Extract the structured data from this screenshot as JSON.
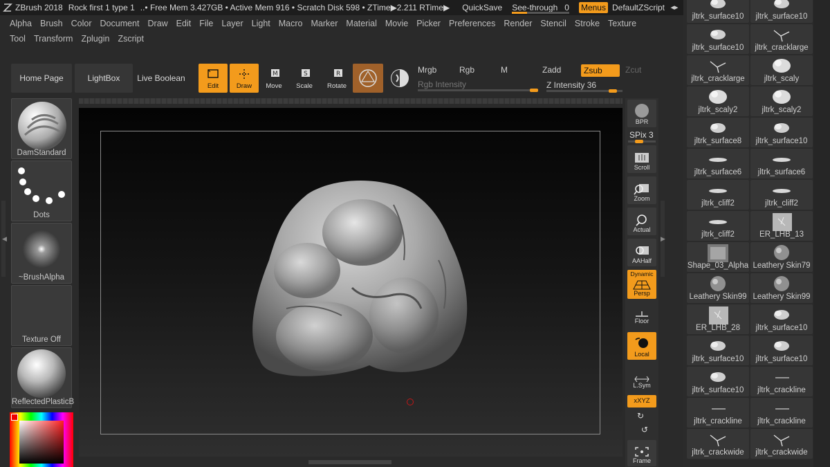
{
  "titlebar": {
    "app": "ZBrush 2018",
    "doc": "Rock first 1 type 1",
    "mem": "..• Free Mem 3.427GB • Active Mem 916 • Scratch Disk 598 • ZTime▶2.211 RTime▶",
    "quicksave": "QuickSave",
    "seethrough": "See-through",
    "seethrough_value": "0",
    "menus": "Menus",
    "script": "DefaultZScript"
  },
  "menu_row1": [
    "Alpha",
    "Brush",
    "Color",
    "Document",
    "Draw",
    "Edit",
    "File",
    "Layer",
    "Light",
    "Macro",
    "Marker",
    "Material",
    "Movie",
    "Picker",
    "Preferences",
    "Render",
    "Stencil",
    "Stroke",
    "Texture"
  ],
  "menu_row2": [
    "Tool",
    "Transform",
    "Zplugin",
    "Zscript"
  ],
  "topbar": {
    "home": "Home Page",
    "lightbox": "LightBox",
    "liveboolean": "Live Boolean",
    "edit": "Edit",
    "draw": "Draw",
    "move": "Move",
    "scale": "Scale",
    "rotate": "Rotate",
    "mrgb": "Mrgb",
    "rgb": "Rgb",
    "m": "M",
    "zadd": "Zadd",
    "zsub": "Zsub",
    "zcut": "Zcut",
    "rgb_intensity": "Rgb Intensity",
    "z_intensity_label": "Z Intensity",
    "z_intensity": "36"
  },
  "left_panel": {
    "brush": "DamStandard",
    "stroke": "Dots",
    "alpha": "~BrushAlpha",
    "texture": "Texture Off",
    "material": "ReflectedPlasticB"
  },
  "right_toolbar": {
    "bpr": "BPR",
    "spix_label": "SPix",
    "spix": "3",
    "scroll": "Scroll",
    "zoom": "Zoom",
    "actual": "Actual",
    "aahalf": "AAHalf",
    "dynamic": "Dynamic",
    "persp": "Persp",
    "floor": "Floor",
    "local": "Local",
    "lsym": "L.Sym",
    "xyz": "xXYZ",
    "frame": "Frame"
  },
  "alphas": [
    "jltrk_surface10",
    "jltrk_surface10",
    "jltrk_surface10",
    "jltrk_cracklarge",
    "jltrk_cracklarge",
    "jltrk_scaly",
    "jltrk_scaly2",
    "jltrk_scaly2",
    "jltrk_surface8",
    "jltrk_surface10",
    "jltrk_surface6",
    "jltrk_surface6",
    "jltrk_cliff2",
    "jltrk_cliff2",
    "jltrk_cliff2",
    "ER_LHB_13",
    "Shape_03_Alpha",
    "Leathery Skin79",
    "Leathery Skin99",
    "Leathery Skin99",
    "ER_LHB_28",
    "jltrk_surface10",
    "jltrk_surface10",
    "jltrk_surface10",
    "jltrk_surface10",
    "jltrk_crackline",
    "jltrk_crackline",
    "jltrk_crackline",
    "jltrk_crackwide",
    "jltrk_crackwide"
  ],
  "colors": {
    "accent": "#f39b1c",
    "panel": "#363636",
    "background": "#2a2a2a"
  }
}
